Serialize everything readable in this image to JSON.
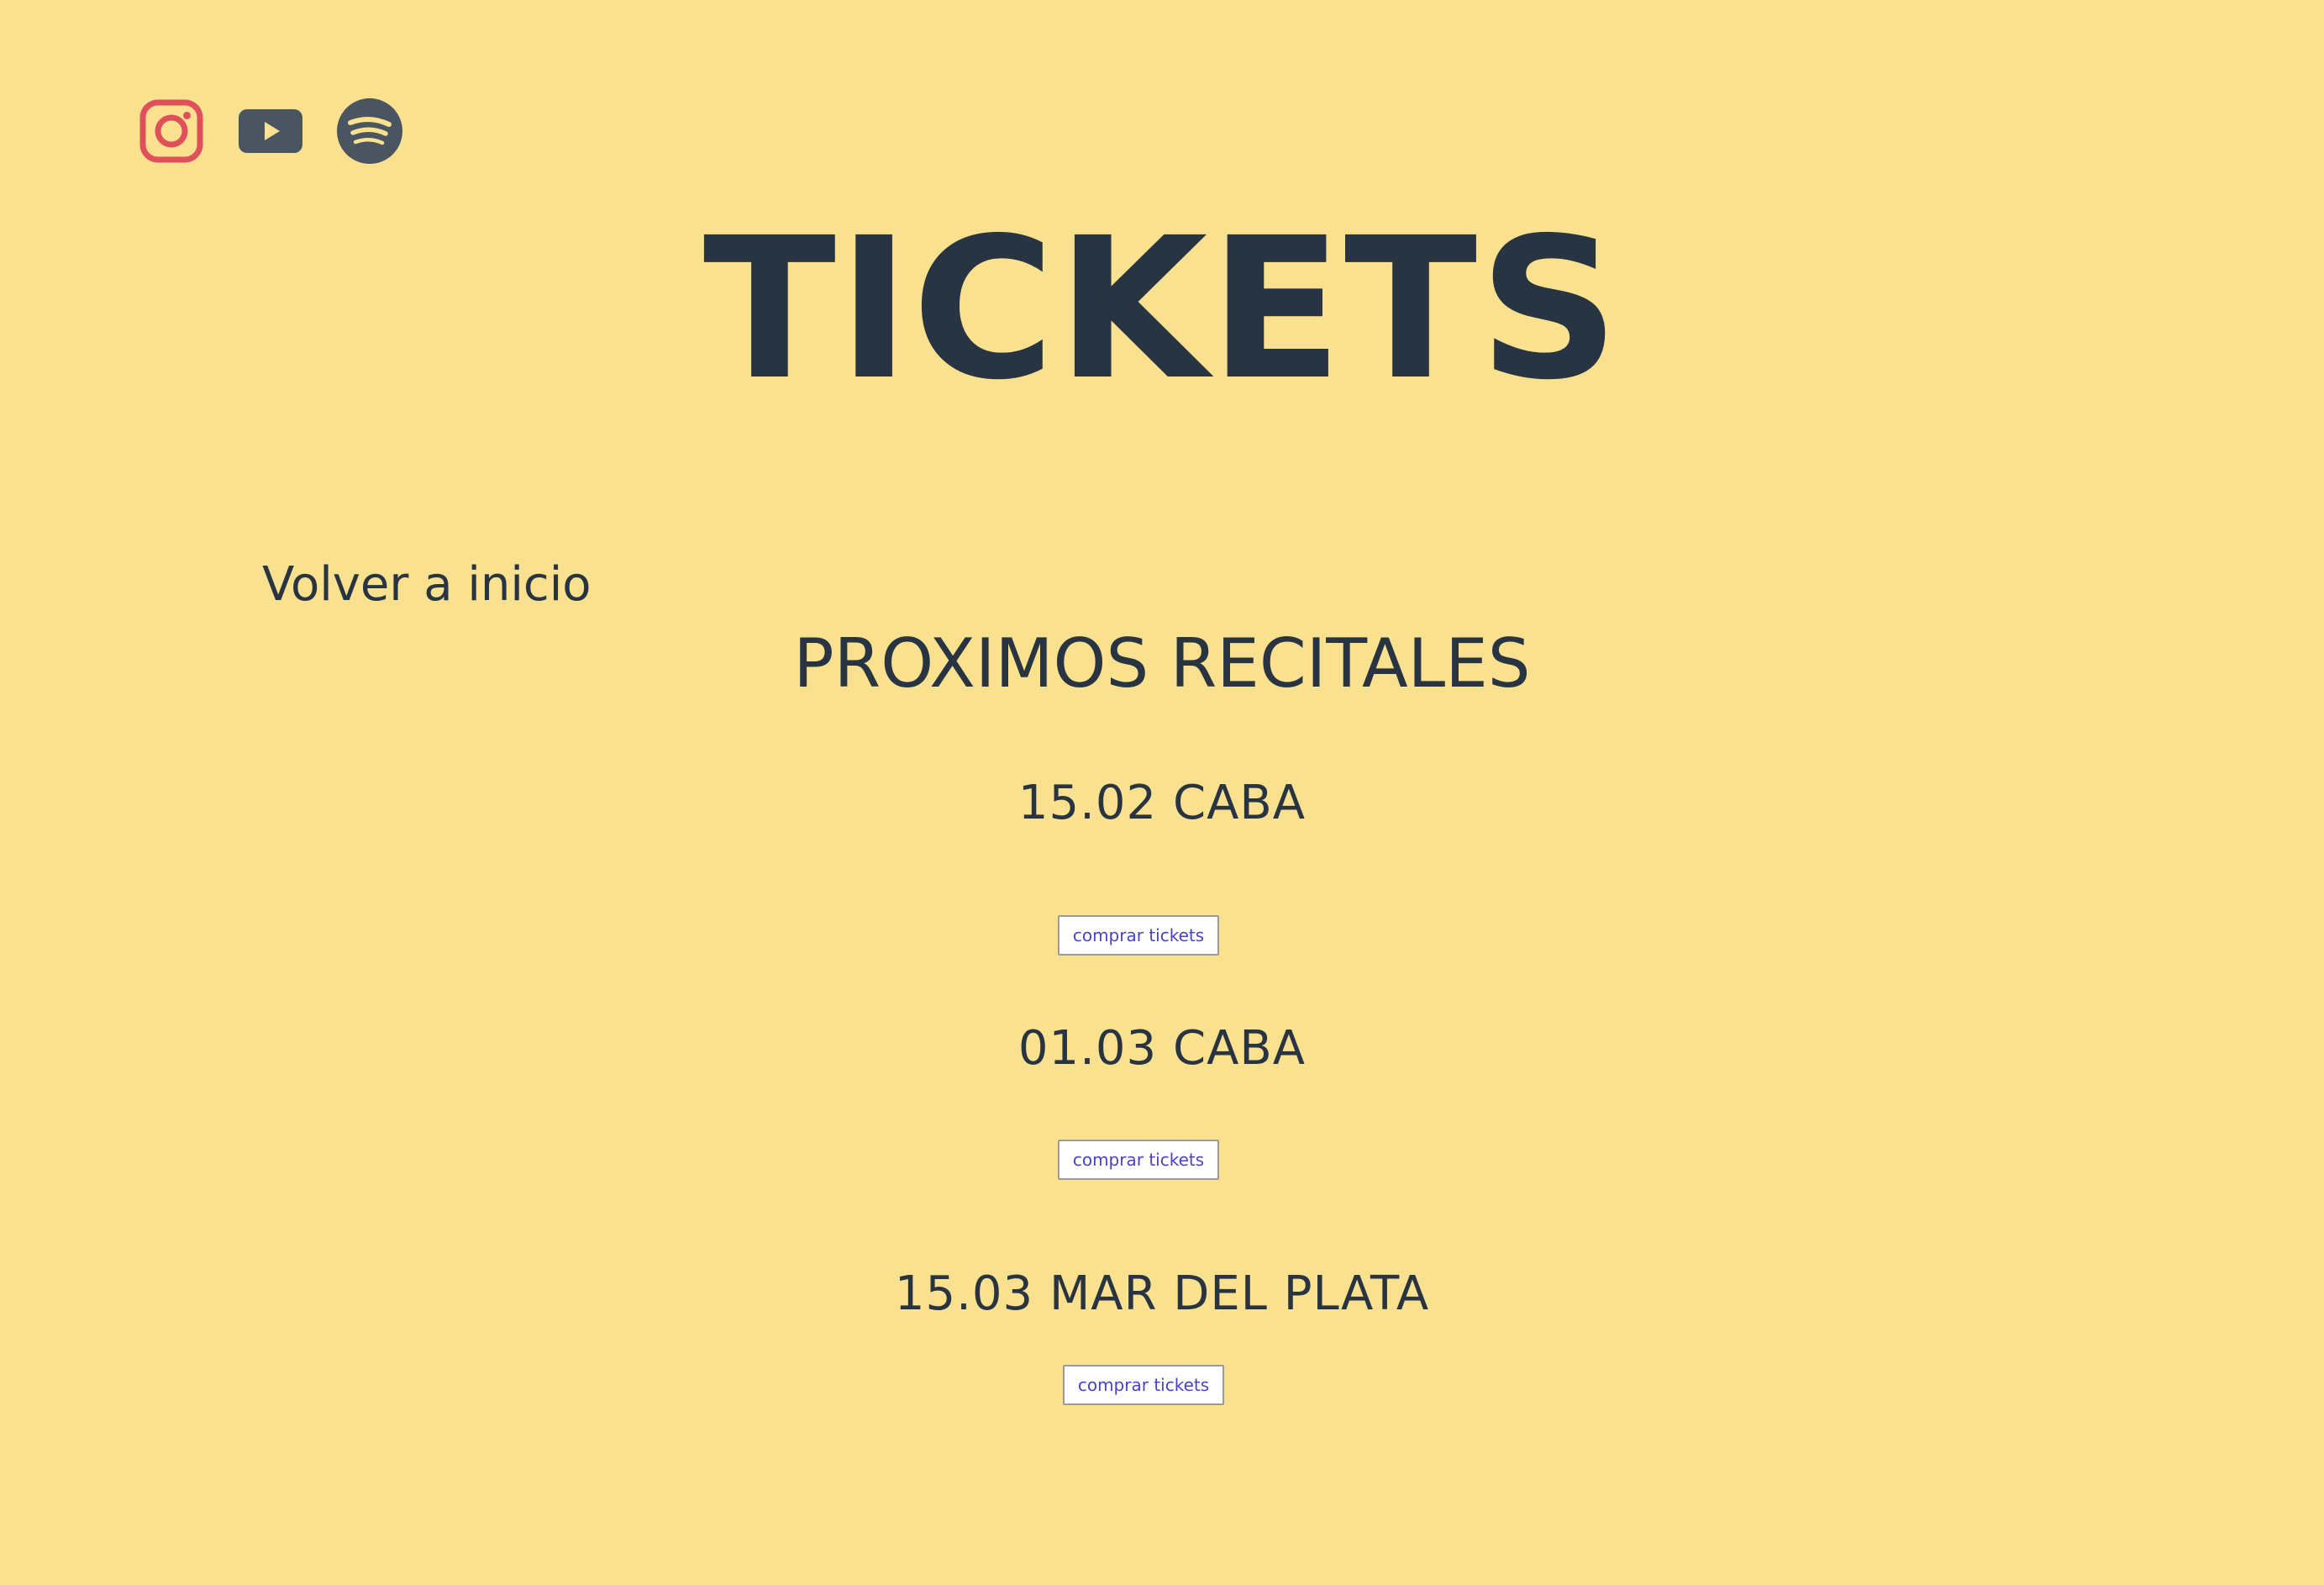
{
  "social": {
    "instagram_color": "#e0505a",
    "icon_color": "#4a5561",
    "background_color": "#fae18f",
    "items": [
      {
        "icon": "instagram-icon"
      },
      {
        "icon": "youtube-icon"
      },
      {
        "icon": "spotify-icon"
      }
    ]
  },
  "header": {
    "title": "TICKETS"
  },
  "nav": {
    "back_label": "Volver a inicio"
  },
  "main": {
    "section_title": "PROXIMOS RECITALES",
    "concerts": [
      {
        "label": "15.02 CABA",
        "button_label": "comprar tickets"
      },
      {
        "label": "01.03 CABA",
        "button_label": "comprar tickets"
      },
      {
        "label": "15.03 MAR DEL PLATA",
        "button_label": "comprar tickets"
      }
    ]
  }
}
